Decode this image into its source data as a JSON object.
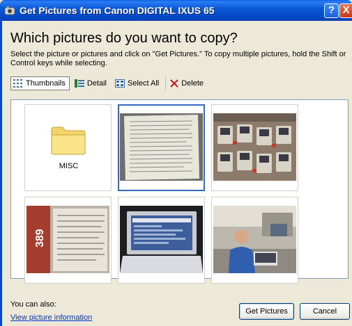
{
  "window": {
    "title": "Get Pictures from Canon DIGITAL IXUS 65",
    "help_symbol": "?",
    "close_symbol": "X"
  },
  "heading": "Which pictures do you want to copy?",
  "instructions": "Select the picture or pictures and click on \"Get Pictures.\" To copy multiple pictures, hold the Shift or Control keys while selecting.",
  "toolbar": {
    "thumbnails_label": "Thumbnails",
    "detail_label": "Detail",
    "select_all_label": "Select All",
    "delete_label": "Delete"
  },
  "thumbnails": {
    "folder_label": "MISC",
    "items": [
      {
        "type": "folder",
        "label": "MISC"
      },
      {
        "type": "photo",
        "subject": "printed document page",
        "selected": true
      },
      {
        "type": "photo",
        "subject": "mobile phones on a store display"
      },
      {
        "type": "photo",
        "subject": "price tag close-up"
      },
      {
        "type": "photo",
        "subject": "laptop screen"
      },
      {
        "type": "photo",
        "subject": "man at a computer desk"
      }
    ]
  },
  "footer": {
    "you_can_also": "You can also:",
    "view_info_link": "View picture information",
    "get_pictures_button": "Get Pictures",
    "cancel_button": "Cancel"
  },
  "colors": {
    "titlebar_blue": "#0447c4",
    "selection_blue": "#316ac5",
    "link_blue": "#0033cc",
    "dialog_bg": "#ece9d8"
  },
  "price_text": "389"
}
